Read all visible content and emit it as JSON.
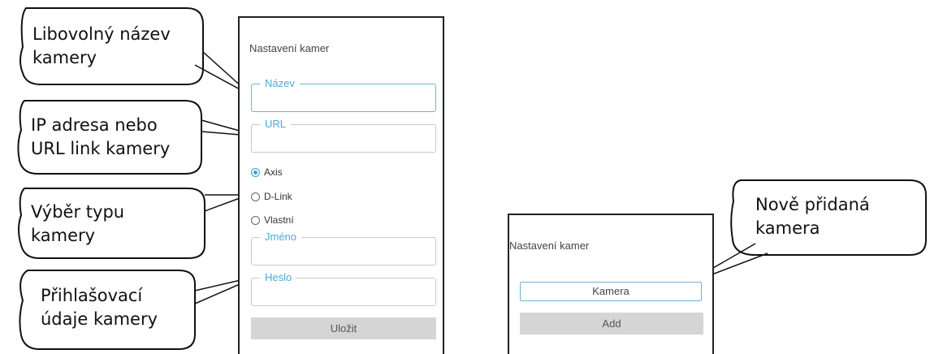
{
  "callouts": [
    {
      "line1": "Libovolný název",
      "line2": "kamery"
    },
    {
      "line1": "IP adresa nebo",
      "line2": "URL link kamery"
    },
    {
      "line1": "Výběr typu",
      "line2": "kamery"
    },
    {
      "line1": "Přihlašovací",
      "line2": "údaje kamery"
    },
    {
      "line1": "Nově přidaná",
      "line2": "kamera"
    }
  ],
  "settings_form": {
    "title": "Nastavení kamer",
    "name_label": "Název",
    "name_value": "",
    "url_label": "URL",
    "url_value": "",
    "camera_types": [
      {
        "label": "Axis",
        "selected": true
      },
      {
        "label": "D-Link",
        "selected": false
      },
      {
        "label": "Vlastní",
        "selected": false
      }
    ],
    "username_label": "Jméno",
    "username_value": "",
    "password_label": "Heslo",
    "password_value": "",
    "save_label": "Uložit"
  },
  "camera_list": {
    "title": "Nastavení kamer",
    "camera_name": "Kamera",
    "add_label": "Add"
  },
  "colors": {
    "accent": "#4aa9d6",
    "button_bg": "#d5d5d5",
    "panel_border": "#222222"
  }
}
